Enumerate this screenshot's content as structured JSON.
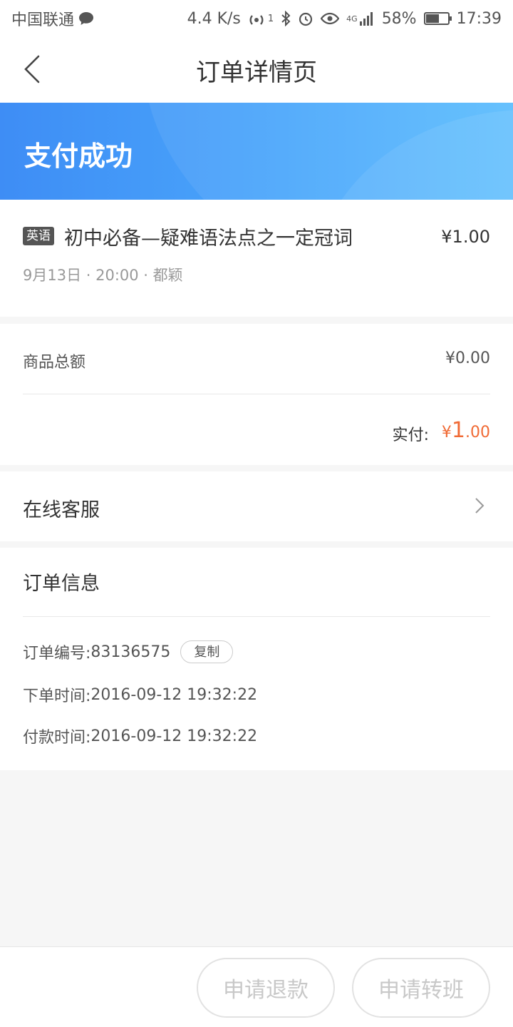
{
  "status_bar": {
    "carrier": "中国联通",
    "speed": "4.4 K/s",
    "network_sup": "1",
    "signal_type": "4G",
    "battery_percent": "58%",
    "time": "17:39"
  },
  "nav": {
    "title": "订单详情页"
  },
  "banner": {
    "title": "支付成功"
  },
  "course": {
    "tag": "英语",
    "title": "初中必备—疑难语法点之一定冠词",
    "price": "¥1.00",
    "meta": "9月13日 · 20:00 · 都颖"
  },
  "totals": {
    "goods_total_label": "商品总额",
    "goods_total_value": "¥0.00",
    "paid_label": "实付:",
    "paid_currency": "¥",
    "paid_int": "1",
    "paid_dec": ".00"
  },
  "service": {
    "label": "在线客服"
  },
  "order_info": {
    "title": "订单信息",
    "order_no_label": "订单编号:",
    "order_no": "83136575",
    "copy_label": "复制",
    "order_time_label": "下单时间:",
    "order_time": "2016-09-12 19:32:22",
    "pay_time_label": "付款时间:",
    "pay_time": "2016-09-12 19:32:22"
  },
  "actions": {
    "refund_label": "申请退款",
    "transfer_label": "申请转班"
  },
  "colors": {
    "banner_start": "#3e8df5",
    "banner_end": "#5bbdfd",
    "paid_accent": "#f06a35"
  }
}
